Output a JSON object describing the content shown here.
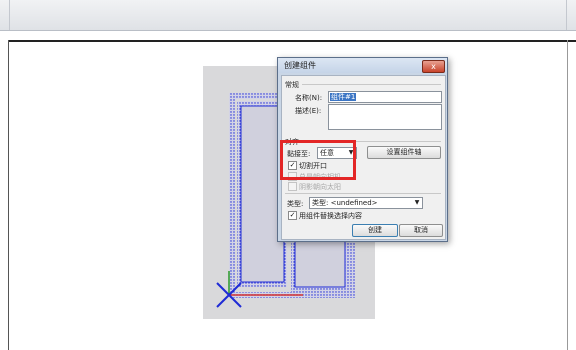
{
  "dialog": {
    "title": "创建组件",
    "close_glyph": "x",
    "general_group": "常规",
    "name_label": "名称(N):",
    "name_value": "组件#1",
    "description_label": "描述(E):",
    "description_value": "",
    "alignment_group": "对齐",
    "glue_to_label": "黏接至:",
    "glue_to_value": "任意",
    "set_axes_button": "设置组件轴",
    "cut_opening_label": "切割开口",
    "cut_opening_checked": true,
    "always_face_camera_label": "总是朝向相机",
    "shadows_face_sun_label": "阴影朝向太阳",
    "type_label": "类型:",
    "type_value": "类型: <undefined>",
    "replace_selection_label": "用组件替换选择内容",
    "replace_selection_checked": true,
    "create_button": "创建",
    "cancel_button": "取消"
  },
  "colors": {
    "highlight": "#e32626",
    "selection": "#3b75c4",
    "hatch": "#1f2bd6"
  },
  "icons": [
    "close-icon",
    "chevron-down-icon",
    "check-icon",
    "axes-icon"
  ]
}
